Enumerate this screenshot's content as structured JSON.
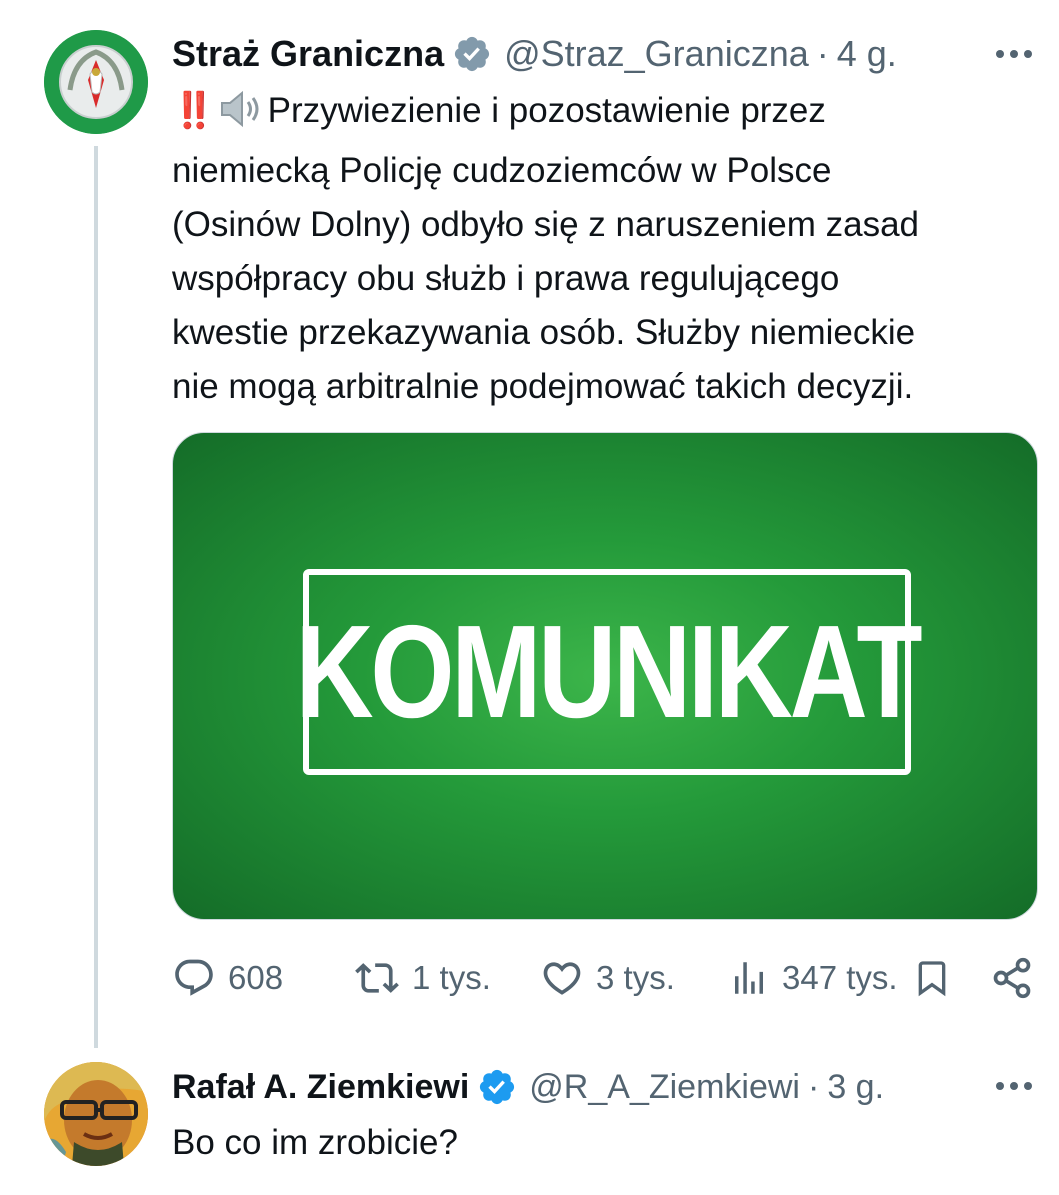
{
  "tweet": {
    "author_name": "Straż Graniczna",
    "handle": "@Straz_Graniczna",
    "separator": "·",
    "time": "4 g.",
    "verified_badge_color": "#829aab",
    "text_lines": [
      "Przywiezienie i pozostawienie przez",
      "niemiecką Policję cudzoziemców w Polsce",
      "(Osinów Dolny) odbyło się z naruszeniem zasad",
      "współpracy obu służb i prawa regulującego",
      "kwestie przekazywania osób. Służby niemieckie",
      "nie mogą arbitralnie podejmować takich decyzji."
    ],
    "emoji_prefix": "‼️",
    "media_text": "KOMUNIKAT",
    "media_bg_color": "#249a3a",
    "actions": {
      "replies": "608",
      "reposts": "1 tys.",
      "likes": "3 tys.",
      "views": "347 tys."
    }
  },
  "reply": {
    "author_name": "Rafał A. Ziemkiewi",
    "handle": "@R_A_Ziemkiewi",
    "separator": "·",
    "time": "3 g.",
    "verified_badge_color": "#1d9bf0",
    "text": "Bo co im zrobicie?"
  },
  "icons": {
    "reply": "reply-icon",
    "repost": "repost-icon",
    "like": "heart-icon",
    "views": "views-icon",
    "bookmark": "bookmark-icon",
    "share": "share-icon",
    "more": "more-icon",
    "speaker": "speaker-icon"
  },
  "colors": {
    "text_primary": "#0f1419",
    "text_secondary": "#536471",
    "accent_blue": "#1d9bf0"
  }
}
